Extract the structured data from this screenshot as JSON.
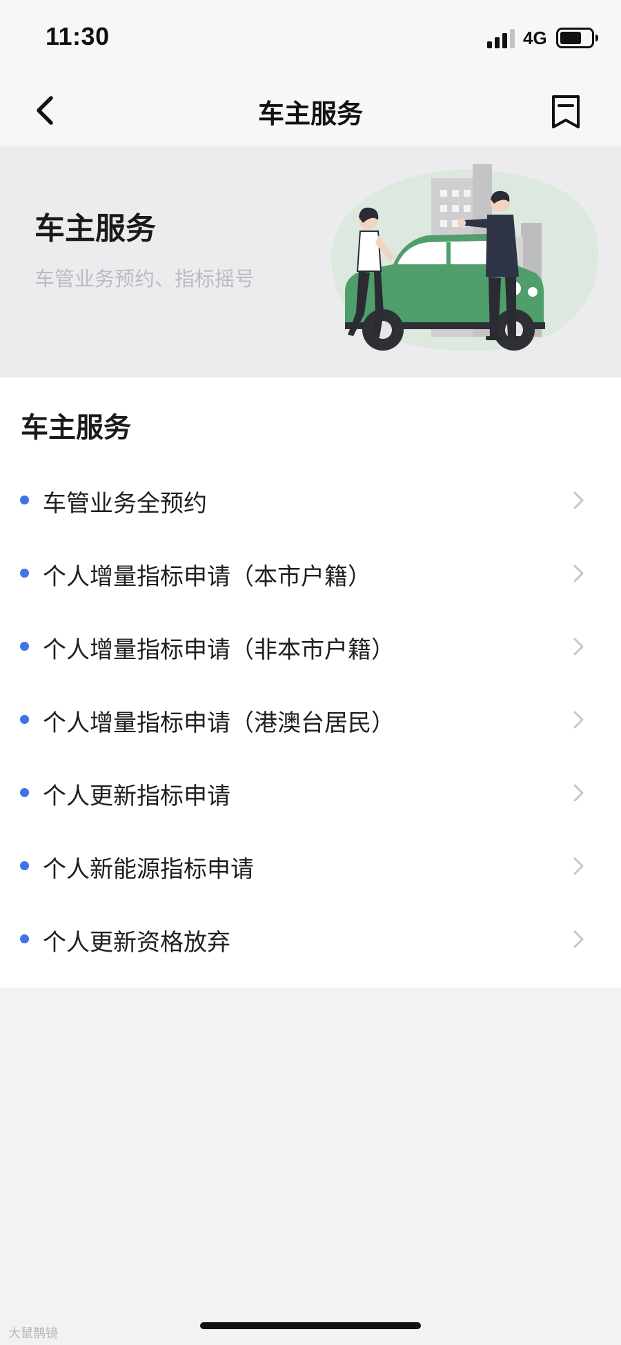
{
  "status_bar": {
    "time": "11:30",
    "network": "4G",
    "icons": [
      "signal-icon",
      "battery-icon"
    ]
  },
  "nav": {
    "title": "车主服务",
    "icons": [
      "back-icon",
      "bookmark-icon"
    ]
  },
  "banner": {
    "title": "车主服务",
    "subtitle": "车管业务预约、指标摇号",
    "illustration": "car-owners-illustration",
    "colors": {
      "car": "#4f9e6b",
      "blob": "#dde8df",
      "buildings": "#cfcfd1"
    }
  },
  "services": {
    "section_title": "车主服务",
    "items": [
      {
        "label": "车管业务全预约"
      },
      {
        "label": "个人增量指标申请（本市户籍）"
      },
      {
        "label": "个人增量指标申请（非本市户籍）"
      },
      {
        "label": "个人增量指标申请（港澳台居民）"
      },
      {
        "label": "个人更新指标申请"
      },
      {
        "label": "个人新能源指标申请"
      },
      {
        "label": "个人更新资格放弃"
      }
    ],
    "bullet_color": "#3f73e8",
    "item_icon": "chevron-right-icon"
  },
  "watermark": "大鼠鹊镜"
}
